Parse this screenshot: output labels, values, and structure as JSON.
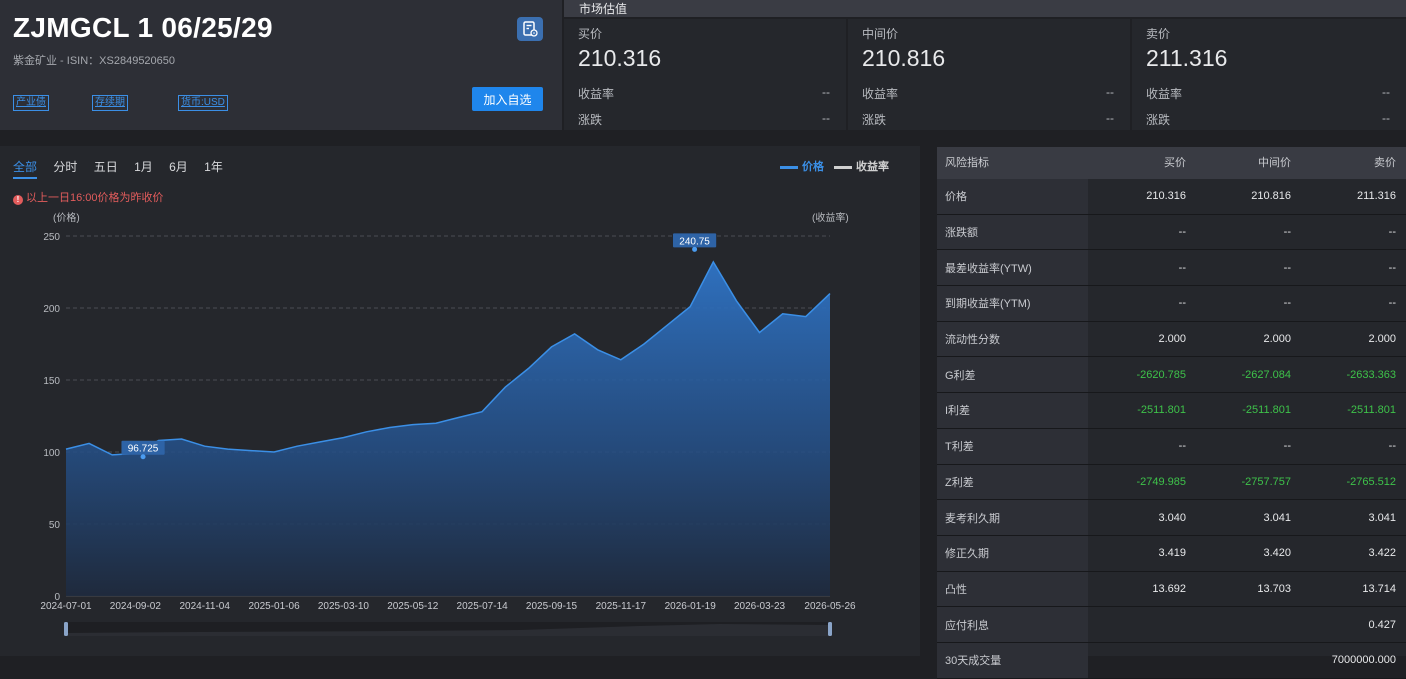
{
  "bond": {
    "title": "ZJMGCL 1 06/25/29",
    "subtitle": "紫金矿业 - ISIN：XS2849520650",
    "tags": [
      "产业债",
      "存续期",
      "货币:USD"
    ],
    "add_label": "加入自选"
  },
  "market": {
    "header": "市场估值",
    "quotes": [
      {
        "label": "买价",
        "price": "210.316",
        "yield_label": "收益率",
        "yield": "--",
        "change_label": "涨跌",
        "change": "--"
      },
      {
        "label": "中间价",
        "price": "210.816",
        "yield_label": "收益率",
        "yield": "--",
        "change_label": "涨跌",
        "change": "--"
      },
      {
        "label": "卖价",
        "price": "211.316",
        "yield_label": "收益率",
        "yield": "--",
        "change_label": "涨跌",
        "change": "--"
      }
    ]
  },
  "chart_tabs": [
    "全部",
    "分时",
    "五日",
    "1月",
    "6月",
    "1年"
  ],
  "active_tab": "全部",
  "legend": {
    "price": "价格",
    "yield": "收益率",
    "price_color": "#3b8fe6",
    "yield_color": "#d0d0d0"
  },
  "note": "以上一日16:00价格为昨收价",
  "chart_data": {
    "type": "area",
    "ylabel": "(价格)",
    "y2label": "(收益率)",
    "ylim": [
      0,
      250
    ],
    "yticks": [
      0,
      50,
      100,
      150,
      200,
      250
    ],
    "xticks": [
      "2024-07-01",
      "2024-09-02",
      "2024-11-04",
      "2025-01-06",
      "2025-03-10",
      "2025-05-12",
      "2025-07-14",
      "2025-09-15",
      "2025-11-17",
      "2026-01-19",
      "2026-03-23",
      "2026-05-26"
    ],
    "series": [
      {
        "name": "价格",
        "x": [
          "2024-07-01",
          "2024-07-22",
          "2024-08-12",
          "2024-09-02",
          "2024-09-23",
          "2024-10-14",
          "2024-11-04",
          "2024-11-25",
          "2024-12-16",
          "2025-01-06",
          "2025-01-27",
          "2025-02-17",
          "2025-03-10",
          "2025-03-31",
          "2025-04-21",
          "2025-05-12",
          "2025-06-02",
          "2025-06-23",
          "2025-07-14",
          "2025-08-04",
          "2025-08-25",
          "2025-09-15",
          "2025-10-06",
          "2025-10-27",
          "2025-11-17",
          "2025-12-08",
          "2025-12-29",
          "2026-01-19",
          "2026-02-09",
          "2026-03-02",
          "2026-03-23",
          "2026-04-13",
          "2026-05-04",
          "2026-05-26"
        ],
        "values": [
          102,
          106,
          98,
          99,
          108,
          109,
          104,
          102,
          101,
          100,
          104,
          107,
          110,
          114,
          117,
          119,
          120,
          124,
          128,
          145,
          158,
          173,
          182,
          171,
          164,
          175,
          188,
          201,
          232,
          205,
          183,
          196,
          194,
          210
        ]
      }
    ],
    "annotations": [
      {
        "x": "2026-01-23",
        "y": 240.75,
        "label": "240.75"
      },
      {
        "x": "2024-09-09",
        "y": 96.725,
        "label": "96.725"
      }
    ]
  },
  "risk": {
    "headers": [
      "风险指标",
      "买价",
      "中间价",
      "卖价"
    ],
    "rows": [
      {
        "label": "价格",
        "bid": "210.316",
        "mid": "210.816",
        "ask": "211.316"
      },
      {
        "label": "涨跌额",
        "bid": "--",
        "mid": "--",
        "ask": "--"
      },
      {
        "label": "最差收益率(YTW)",
        "bid": "--",
        "mid": "--",
        "ask": "--"
      },
      {
        "label": "到期收益率(YTM)",
        "bid": "--",
        "mid": "--",
        "ask": "--"
      },
      {
        "label": "流动性分数",
        "bid": "2.000",
        "mid": "2.000",
        "ask": "2.000"
      },
      {
        "label": "G利差",
        "bid": "-2620.785",
        "mid": "-2627.084",
        "ask": "-2633.363"
      },
      {
        "label": "I利差",
        "bid": "-2511.801",
        "mid": "-2511.801",
        "ask": "-2511.801"
      },
      {
        "label": "T利差",
        "bid": "--",
        "mid": "--",
        "ask": "--"
      },
      {
        "label": "Z利差",
        "bid": "-2749.985",
        "mid": "-2757.757",
        "ask": "-2765.512"
      },
      {
        "label": "麦考利久期",
        "bid": "3.040",
        "mid": "3.041",
        "ask": "3.041"
      },
      {
        "label": "修正久期",
        "bid": "3.419",
        "mid": "3.420",
        "ask": "3.422"
      },
      {
        "label": "凸性",
        "bid": "13.692",
        "mid": "13.703",
        "ask": "13.714"
      },
      {
        "label": "应付利息",
        "bid": "",
        "mid": "",
        "ask": "0.427"
      },
      {
        "label": "30天成交量",
        "bid": "",
        "mid": "",
        "ask": "7000000.000"
      }
    ]
  }
}
